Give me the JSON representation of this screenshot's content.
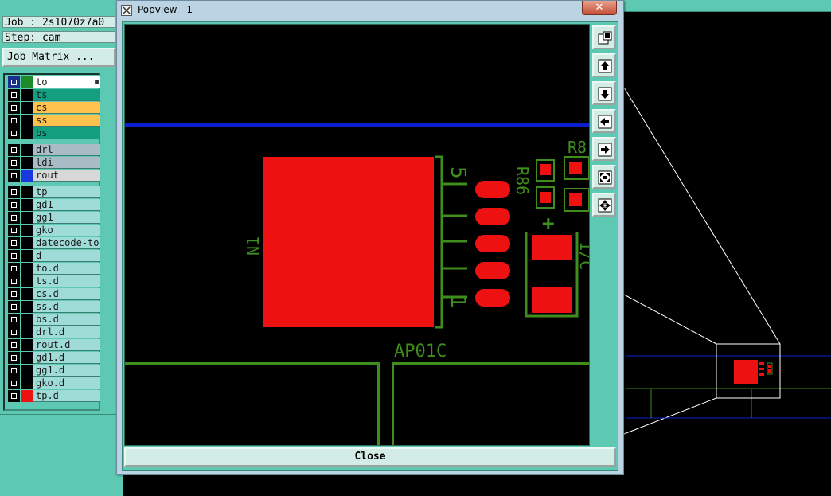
{
  "job_panel": {
    "job_line": "Job : 2s1070z7a0",
    "step_line": "Step: cam",
    "job_matrix_button": "Job Matrix ..."
  },
  "layers": [
    {
      "name": "to",
      "color": "#ffffff",
      "swatch": "#1f8a2a",
      "active": true
    },
    {
      "name": "ts",
      "color": "#14a080",
      "swatch": "#000000"
    },
    {
      "name": "cs",
      "color": "#ffc34d",
      "swatch": "#000000"
    },
    {
      "name": "ss",
      "color": "#ffc34d",
      "swatch": "#000000"
    },
    {
      "name": "bs",
      "color": "#14a080",
      "swatch": "#000000"
    },
    {
      "name": "drl",
      "color": "#a9bcc6",
      "swatch": "#000000"
    },
    {
      "name": "ldi",
      "color": "#a9bcc6",
      "swatch": "#000000"
    },
    {
      "name": "rout",
      "color": "#d8d8d8",
      "swatch": "#1838e0"
    },
    {
      "name": "tp",
      "color": "#9fdcd8",
      "swatch": "#000000"
    },
    {
      "name": "gd1",
      "color": "#9fdcd8",
      "swatch": "#000000"
    },
    {
      "name": "gg1",
      "color": "#9fdcd8",
      "swatch": "#000000"
    },
    {
      "name": "gko",
      "color": "#9fdcd8",
      "swatch": "#000000"
    },
    {
      "name": "datecode-to",
      "color": "#9fdcd8",
      "swatch": "#000000"
    },
    {
      "name": "d",
      "color": "#9fdcd8",
      "swatch": "#000000"
    },
    {
      "name": "to.d",
      "color": "#9fdcd8",
      "swatch": "#000000"
    },
    {
      "name": "ts.d",
      "color": "#9fdcd8",
      "swatch": "#000000"
    },
    {
      "name": "cs.d",
      "color": "#9fdcd8",
      "swatch": "#000000"
    },
    {
      "name": "ss.d",
      "color": "#9fdcd8",
      "swatch": "#000000"
    },
    {
      "name": "bs.d",
      "color": "#9fdcd8",
      "swatch": "#000000"
    },
    {
      "name": "drl.d",
      "color": "#9fdcd8",
      "swatch": "#000000"
    },
    {
      "name": "rout.d",
      "color": "#9fdcd8",
      "swatch": "#000000"
    },
    {
      "name": "gd1.d",
      "color": "#9fdcd8",
      "swatch": "#000000"
    },
    {
      "name": "gg1.d",
      "color": "#9fdcd8",
      "swatch": "#000000"
    },
    {
      "name": "gko.d",
      "color": "#9fdcd8",
      "swatch": "#000000"
    },
    {
      "name": "tp.d",
      "color": "#9fdcd8",
      "swatch": "#ee1111"
    }
  ],
  "popview": {
    "title": "Popview - 1",
    "close_x": "✕",
    "close_button": "Close",
    "toolbar_icons": [
      "zoom-fit-icon",
      "pan-up-icon",
      "pan-down-icon",
      "pan-left-icon",
      "pan-right-icon",
      "zoom-in-icon",
      "zoom-out-icon"
    ]
  },
  "pcb_view": {
    "labels": {
      "component": "N1",
      "part_number": "AP01C",
      "pin_top": "5",
      "pin_bottom": "1",
      "ref_r86": "R86",
      "ref_r8": "R8",
      "ref_cut": "1/C",
      "polarity": "+"
    },
    "colors": {
      "copper": "#ee1111",
      "silkscreen": "#3f8d1c",
      "profile": "#0c1fd0"
    }
  }
}
